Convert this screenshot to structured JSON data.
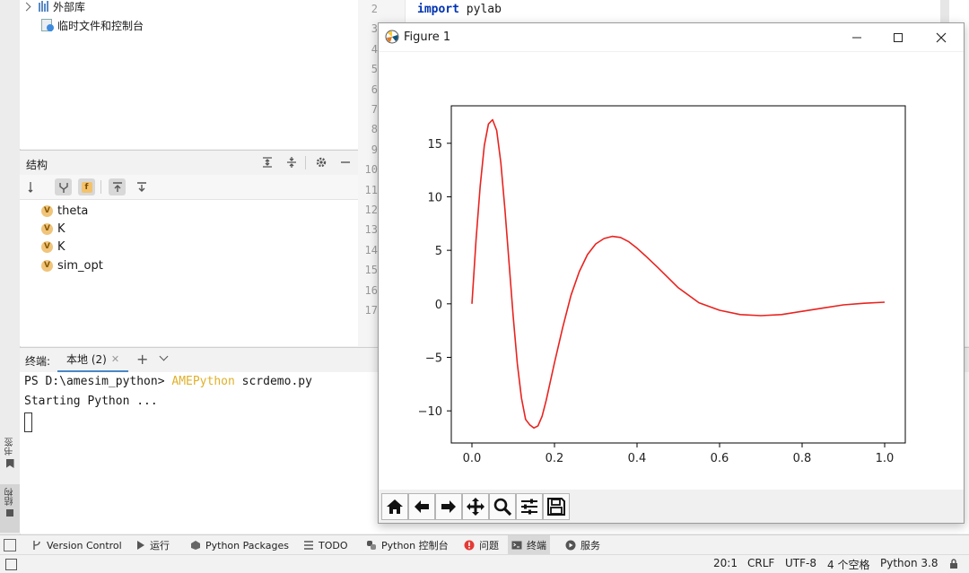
{
  "project_tree": {
    "items": [
      {
        "label": "外部库",
        "icon": "library-icon"
      },
      {
        "label": "临时文件和控制台",
        "icon": "scratches-icon"
      }
    ]
  },
  "structure": {
    "title": "结构",
    "items": [
      {
        "label": "theta",
        "badge": "V"
      },
      {
        "label": "K",
        "badge": "V"
      },
      {
        "label": "K",
        "badge": "V"
      },
      {
        "label": "sim_opt",
        "badge": "V"
      }
    ],
    "toolbar_badge": "f",
    "sort_label": "a z"
  },
  "left_strip": {
    "bookmarks": "书签",
    "structure": "结构"
  },
  "editor": {
    "line_numbers": [
      "2",
      "3",
      "4",
      "5",
      "6",
      "7",
      "8",
      "9",
      "10",
      "11",
      "12",
      "13",
      "14",
      "15",
      "16",
      "17"
    ],
    "code_keyword": "import",
    "code_rest": " pylab"
  },
  "terminal": {
    "title": "终端:",
    "tab_label": "本地 (2)",
    "prompt": "PS D:\\amesim_python> ",
    "command": "AMEPython",
    "args": " scrdemo.py",
    "output": "Starting Python ..."
  },
  "figure": {
    "title": "Figure 1",
    "accent": "#e8231f"
  },
  "chart_data": {
    "type": "line",
    "xlim": [
      -0.05,
      1.05
    ],
    "ylim": [
      -13,
      18.5
    ],
    "xticks": [
      0.0,
      0.2,
      0.4,
      0.6,
      0.8,
      1.0
    ],
    "xtick_labels": [
      "0.0",
      "0.2",
      "0.4",
      "0.6",
      "0.8",
      "1.0"
    ],
    "yticks": [
      -10,
      -5,
      0,
      5,
      10,
      15
    ],
    "ytick_labels": [
      "−10",
      "−5",
      "0",
      "5",
      "10",
      "15"
    ],
    "grid": false,
    "series": [
      {
        "color": "#e8231f",
        "x": [
          0,
          0.01,
          0.02,
          0.03,
          0.04,
          0.05,
          0.06,
          0.07,
          0.08,
          0.09,
          0.1,
          0.11,
          0.12,
          0.13,
          0.14,
          0.15,
          0.16,
          0.17,
          0.18,
          0.2,
          0.22,
          0.24,
          0.26,
          0.28,
          0.3,
          0.32,
          0.34,
          0.36,
          0.38,
          0.4,
          0.42,
          0.45,
          0.5,
          0.55,
          0.6,
          0.65,
          0.7,
          0.75,
          0.8,
          0.85,
          0.9,
          0.95,
          1.0
        ],
        "y": [
          0,
          6,
          11,
          14.8,
          16.8,
          17.2,
          16.2,
          13.2,
          8.8,
          3.8,
          -1.2,
          -5.6,
          -8.8,
          -10.8,
          -11.3,
          -11.6,
          -11.4,
          -10.5,
          -9,
          -5.5,
          -2.2,
          0.8,
          3,
          4.6,
          5.6,
          6.1,
          6.3,
          6.2,
          5.8,
          5.2,
          4.5,
          3.4,
          1.5,
          0.1,
          -0.6,
          -1,
          -1.1,
          -1,
          -0.7,
          -0.4,
          -0.1,
          0.05,
          0.15
        ]
      }
    ]
  },
  "tool_windows": [
    {
      "label": "Version Control",
      "icon": "version-control-icon"
    },
    {
      "label": "运行",
      "icon": "run-icon"
    },
    {
      "label": "Python Packages",
      "icon": "packages-icon"
    },
    {
      "label": "TODO",
      "icon": "todo-icon"
    },
    {
      "label": "Python 控制台",
      "icon": "python-console-icon"
    },
    {
      "label": "问题",
      "icon": "problems-icon"
    },
    {
      "label": "终端",
      "icon": "terminal-icon"
    },
    {
      "label": "服务",
      "icon": "services-icon"
    }
  ],
  "status": {
    "position": "20:1",
    "line_sep": "CRLF",
    "encoding": "UTF-8",
    "indent": "4 个空格",
    "interpreter": "Python 3.8"
  }
}
